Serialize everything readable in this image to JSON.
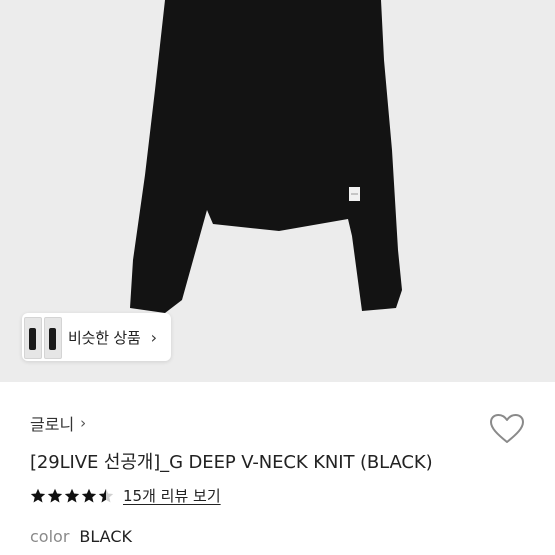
{
  "product_image": {
    "garment_color": "#131313",
    "background_color": "#ececec"
  },
  "similar_button": {
    "label": "비슷한 상품",
    "arrow": "›"
  },
  "brand": {
    "name": "글로니",
    "arrow": "›"
  },
  "wishlist": {
    "icon": "heart-outline-icon"
  },
  "product": {
    "title": "[29LIVE 선공개]_G DEEP V-NECK KNIT (BLACK)",
    "rating": 4.5,
    "review_link": "15개 리뷰 보기"
  },
  "option": {
    "key": "color",
    "value": "BLACK"
  }
}
